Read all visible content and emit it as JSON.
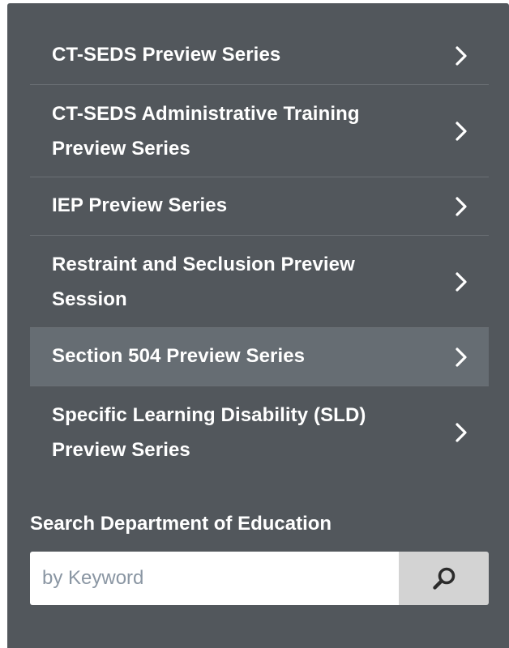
{
  "menu": {
    "items": [
      {
        "label": "CT-SEDS Preview Series",
        "active": false
      },
      {
        "label": "CT-SEDS Administrative Training Preview Series",
        "active": false
      },
      {
        "label": "IEP Preview Series",
        "active": false
      },
      {
        "label": "Restraint and Seclusion Preview Session",
        "active": false
      },
      {
        "label": "Section 504 Preview Series",
        "active": true
      },
      {
        "label": "Specific Learning Disability (SLD) Preview Series",
        "active": false
      }
    ],
    "chevron_icon": "chevron-right-icon"
  },
  "search": {
    "title": "Search Department of Education",
    "placeholder": "by Keyword",
    "value": "",
    "button_icon": "search-icon"
  },
  "colors": {
    "panel_background": "#52575c",
    "active_item_background": "#666d73",
    "divider": "#6b7075",
    "text": "#ffffff",
    "search_button_background": "#d3d3d3",
    "placeholder_text": "#8a96a3"
  }
}
